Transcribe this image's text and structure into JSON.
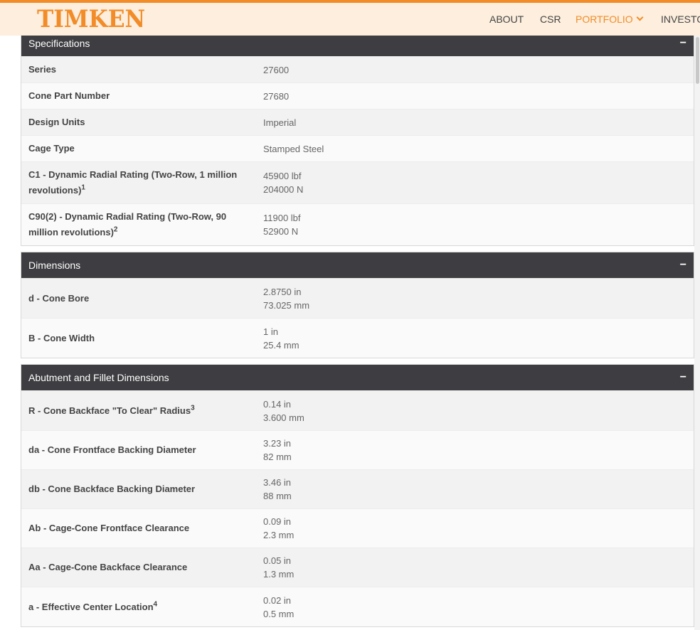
{
  "header": {
    "logo": "TIMKEN",
    "nav": {
      "about": "ABOUT",
      "csr": "CSR",
      "portfolio": "PORTFOLIO",
      "investors": "INVESTORS"
    }
  },
  "specifications": {
    "title": "Specifications",
    "toggle": "−",
    "rows": [
      {
        "label": "Series",
        "values": [
          "27600"
        ]
      },
      {
        "label": "Cone Part Number",
        "values": [
          "27680"
        ]
      },
      {
        "label": "Design Units",
        "values": [
          "Imperial"
        ]
      },
      {
        "label": "Cage Type",
        "values": [
          "Stamped Steel"
        ]
      },
      {
        "label": "C1 - Dynamic Radial Rating (Two-Row, 1 million revolutions)",
        "sup": "1",
        "values": [
          "45900 lbf",
          "204000 N"
        ]
      },
      {
        "label": "C90(2) - Dynamic Radial Rating (Two-Row, 90 million revolutions)",
        "sup": "2",
        "values": [
          "11900 lbf",
          "52900 N"
        ]
      }
    ]
  },
  "dimensions": {
    "title": "Dimensions",
    "toggle": "−",
    "rows": [
      {
        "label": "d - Cone Bore",
        "values": [
          "2.8750 in",
          "73.025 mm"
        ]
      },
      {
        "label": "B - Cone Width",
        "values": [
          "1 in",
          "25.4 mm"
        ]
      }
    ]
  },
  "abutment": {
    "title": "Abutment and Fillet Dimensions",
    "toggle": "−",
    "rows": [
      {
        "label": "R - Cone Backface \"To Clear\" Radius",
        "sup": "3",
        "values": [
          "0.14 in",
          "3.600 mm"
        ]
      },
      {
        "label": "da - Cone Frontface Backing Diameter",
        "values": [
          "3.23 in",
          "82 mm"
        ]
      },
      {
        "label": "db - Cone Backface Backing Diameter",
        "values": [
          "3.46 in",
          "88 mm"
        ]
      },
      {
        "label": "Ab - Cage-Cone Frontface Clearance",
        "values": [
          "0.09 in",
          "2.3 mm"
        ]
      },
      {
        "label": "Aa - Cage-Cone Backface Clearance",
        "values": [
          "0.05 in",
          "1.3 mm"
        ]
      },
      {
        "label": "a - Effective Center Location",
        "sup": "4",
        "values": [
          "0.02 in",
          "0.5 mm"
        ]
      }
    ]
  }
}
